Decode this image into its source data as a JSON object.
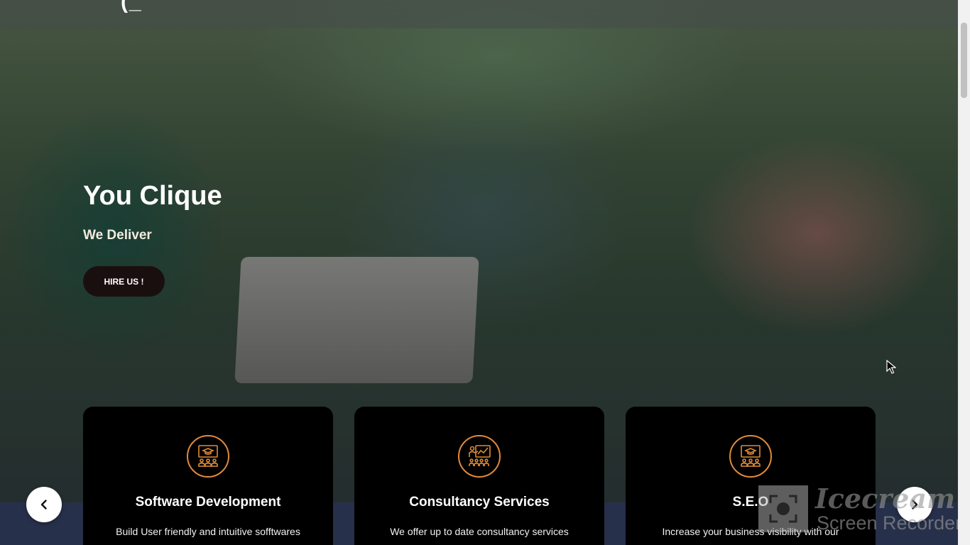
{
  "header": {
    "logo_fragment": "(_"
  },
  "hero": {
    "title": "You Clique",
    "subtitle": "We Deliver",
    "cta_label": "HIRE US !"
  },
  "cards": [
    {
      "title": "Software Development",
      "text": "Build User friendly and intuitive sofftwares",
      "icon": "presentation-board-icon"
    },
    {
      "title": "Consultancy Services",
      "text": "We offer up to date consultancy services",
      "icon": "consultancy-chart-icon"
    },
    {
      "title": "S.E.O",
      "text": "Increase your business visibility with our",
      "icon": "presentation-board-icon"
    }
  ],
  "carousel": {
    "prev_icon": "chevron-left-icon",
    "next_icon": "chevron-right-icon"
  },
  "watermark": {
    "line1": "Icecream",
    "line2": "Screen Recorder"
  },
  "colors": {
    "accent": "#e08a3a",
    "card_bg": "#000000",
    "button_bg": "#1a0f0f"
  }
}
